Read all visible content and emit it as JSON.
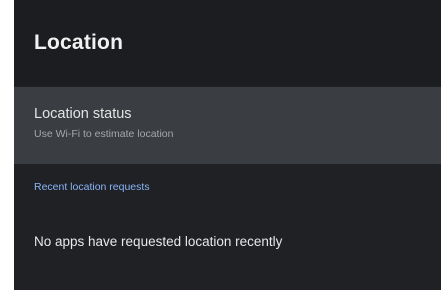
{
  "header": {
    "title": "Location"
  },
  "location_status": {
    "title": "Location status",
    "subtitle": "Use Wi-Fi to estimate location"
  },
  "recent_requests": {
    "section_title": "Recent location requests",
    "empty_message": "No apps have requested location recently"
  },
  "colors": {
    "background": "#1f2125",
    "header_background": "#1b1d20",
    "selected_item_background": "#3a3d42",
    "accent": "#8ab4f8"
  }
}
